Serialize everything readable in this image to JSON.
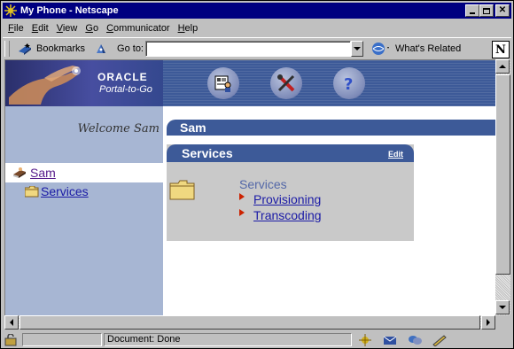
{
  "window": {
    "title": "My Phone - Netscape"
  },
  "menu": [
    "File",
    "Edit",
    "View",
    "Go",
    "Communicator",
    "Help"
  ],
  "menu_underline": [
    "F",
    "E",
    "V",
    "G",
    "C",
    "H"
  ],
  "location_bar": {
    "bookmarks_label": "Bookmarks",
    "goto_label": "Go to:",
    "url_value": "",
    "whats_related_label": "What's Related",
    "brand_letter": "N"
  },
  "banner": {
    "brand": "ORACLE",
    "product": "Portal-to-Go",
    "icons": [
      "user-profile-icon",
      "tools-icon",
      "help-icon"
    ]
  },
  "left_panel": {
    "welcome": "Welcome Sam",
    "tree": [
      {
        "label": "Sam",
        "icon": "user-book-icon",
        "selected": true
      },
      {
        "label": "Services",
        "icon": "folder-icon",
        "selected": false
      }
    ]
  },
  "right_panel": {
    "user_header": "Sam",
    "services_box": {
      "title": "Services",
      "edit_label": "Edit",
      "folder_label": "Services",
      "links": [
        "Provisioning",
        "Transcoding"
      ]
    }
  },
  "status_bar": {
    "text": "Document: Done"
  },
  "colors": {
    "title_bar": "#000080",
    "portal_blue": "#3d5a98",
    "left_panel": "#a7b6d3",
    "box_gray": "#c9c9c9",
    "link": "#1a1aa6"
  }
}
